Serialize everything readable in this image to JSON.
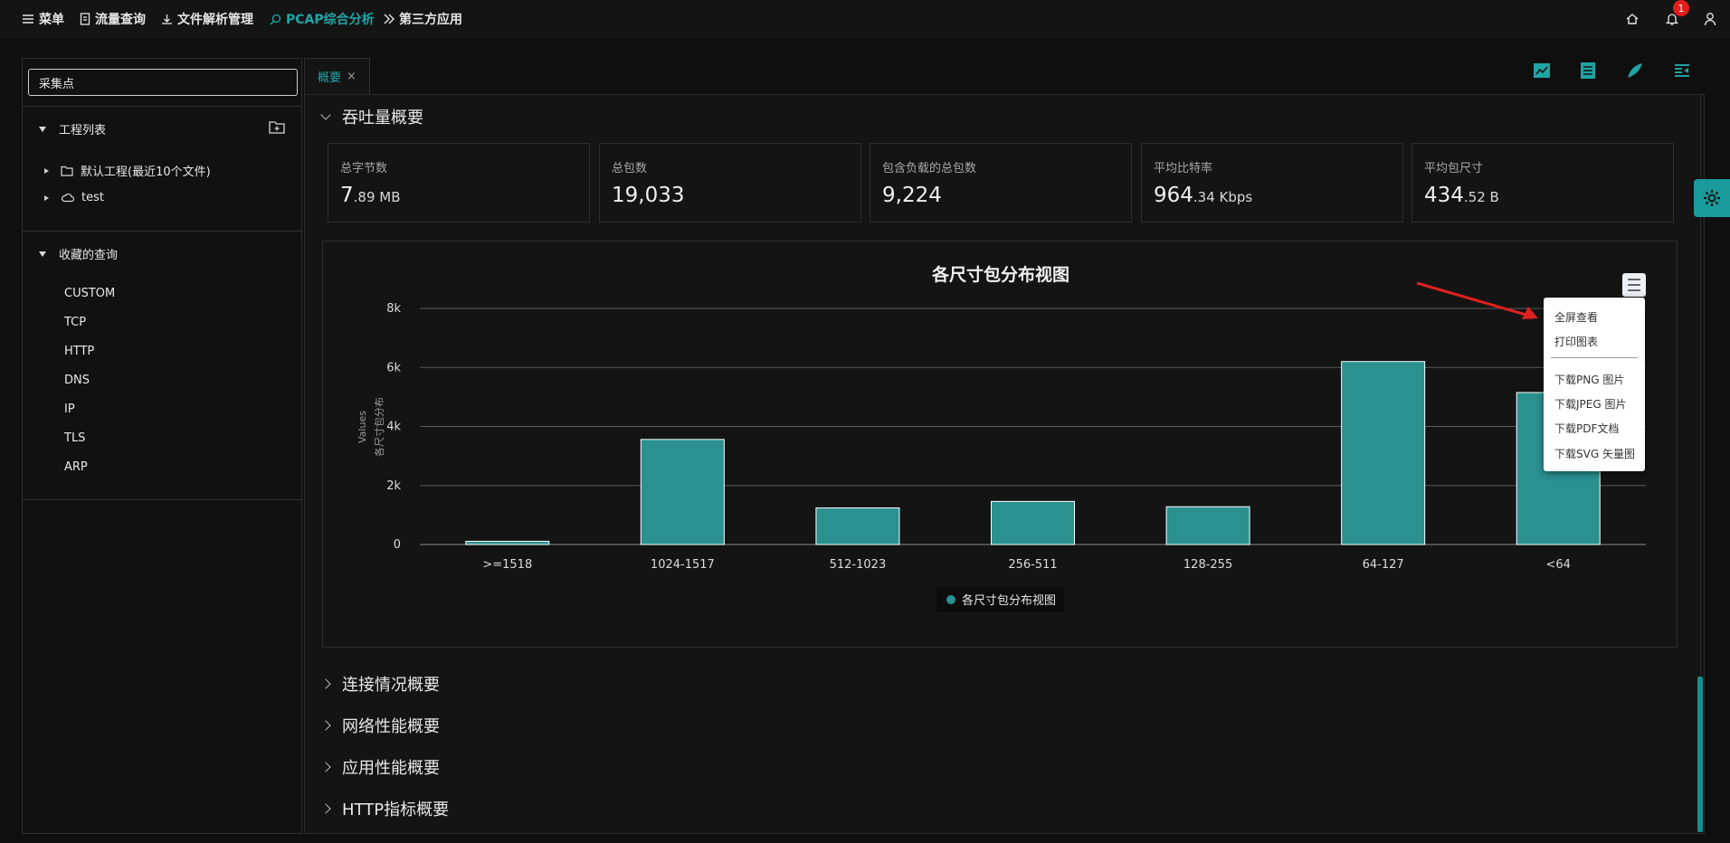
{
  "topbar": {
    "nav": [
      {
        "label": "菜单",
        "icon": "menu-icon"
      },
      {
        "label": "流量查询",
        "icon": "document-icon"
      },
      {
        "label": "文件解析管理",
        "icon": "upload-icon"
      },
      {
        "label": "PCAP综合分析",
        "icon": "search-icon",
        "active": true
      },
      {
        "label": "第三方应用",
        "icon": "double-chevron-icon"
      }
    ],
    "notification_count": "1"
  },
  "sidebar": {
    "search_value": "采集点",
    "project_section": "工程列表",
    "projects": [
      {
        "label": "默认工程(最近10个文件)",
        "icon": "folder-icon"
      },
      {
        "label": "test",
        "icon": "cloud-icon"
      }
    ],
    "favorites_section": "收藏的查询",
    "favorites": [
      "CUSTOM",
      "TCP",
      "HTTP",
      "DNS",
      "IP",
      "TLS",
      "ARP"
    ]
  },
  "tabs": [
    {
      "label": "概要",
      "close": "×"
    }
  ],
  "main": {
    "throughput_title": "吞吐量概要",
    "stats": [
      {
        "label": "总字节数",
        "value": "7",
        "unit": ".89 MB"
      },
      {
        "label": "总包数",
        "value": "19,033",
        "unit": ""
      },
      {
        "label": "包含负载的总包数",
        "value": "9,224",
        "unit": ""
      },
      {
        "label": "平均比特率",
        "value": "964",
        "unit": ".34 Kbps"
      },
      {
        "label": "平均包尺寸",
        "value": "434",
        "unit": ".52 B"
      }
    ],
    "collapsed_sections": [
      "连接情况概要",
      "网络性能概要",
      "应用性能概要",
      "HTTP指标概要"
    ]
  },
  "chart_menu": {
    "items_top": [
      "全屏查看",
      "打印图表"
    ],
    "items_bottom": [
      "下载PNG 图片",
      "下载JPEG 图片",
      "下载PDF文档",
      "下载SVG 矢量图"
    ]
  },
  "chart_data": {
    "type": "bar",
    "title": "各尺寸包分布视图",
    "ylabel_top": "Values",
    "ylabel": "各尺寸包分布",
    "categories": [
      ">=1518",
      "1024-1517",
      "512-1023",
      "256-511",
      "128-255",
      "64-127",
      "<64"
    ],
    "series": [
      {
        "name": "各尺寸包分布视图",
        "values": [
          110,
          3560,
          1240,
          1460,
          1280,
          6200,
          5150
        ]
      }
    ],
    "ylim": [
      0,
      8000
    ],
    "yticks": [
      0,
      2000,
      4000,
      6000,
      8000
    ],
    "ytick_labels": [
      "0",
      "2k",
      "4k",
      "6k",
      "8k"
    ],
    "grid": true,
    "legend": "bottom-center",
    "bar_color": "#2b9090"
  },
  "colors": {
    "accent": "#21a6a6",
    "background": "#141415",
    "badge": "#e21d1d",
    "annotation_arrow": "#e02020"
  }
}
